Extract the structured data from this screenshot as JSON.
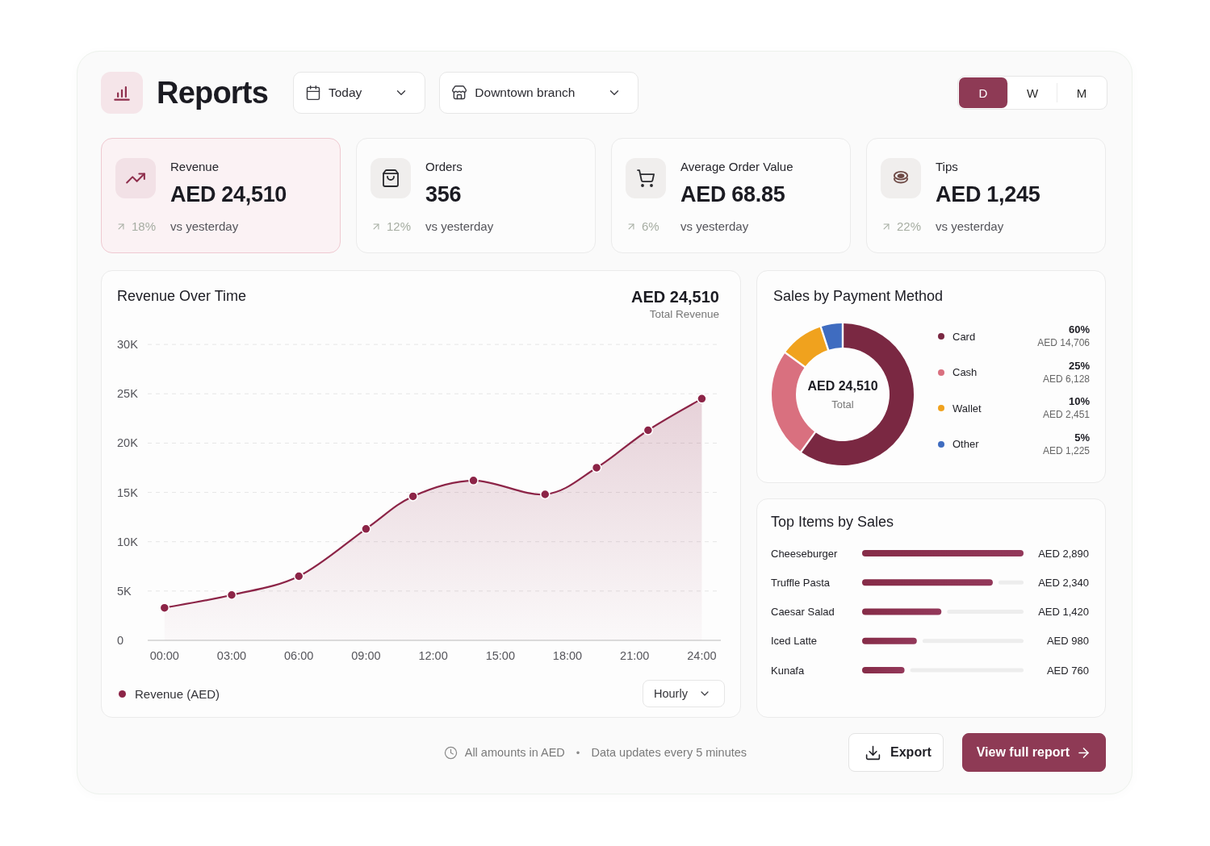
{
  "header": {
    "title": "Reports",
    "filters": [
      {
        "kind": "date",
        "label": "Today"
      },
      {
        "kind": "branch",
        "label": "Downtown branch"
      }
    ],
    "periods": [
      {
        "label": "D",
        "selected": true
      },
      {
        "label": "W",
        "selected": false
      },
      {
        "label": "M",
        "selected": false
      }
    ]
  },
  "kpis": [
    {
      "kind": "revenue",
      "label": "Revenue",
      "value": "AED 24,510",
      "change": "18%",
      "comparison": "vs yesterday",
      "selected": true
    },
    {
      "kind": "orders",
      "label": "Orders",
      "value": "356",
      "change": "12%",
      "comparison": "vs yesterday",
      "selected": false
    },
    {
      "kind": "average_order",
      "label": "Average Order Value",
      "value": "AED 68.85",
      "change": "6%",
      "comparison": "vs yesterday",
      "selected": false
    },
    {
      "kind": "tips",
      "label": "Tips",
      "value": "AED 1,245",
      "change": "22%",
      "comparison": "vs yesterday",
      "selected": false
    }
  ],
  "revenue_chart": {
    "title": "Revenue Over Time",
    "total": "AED 24,510",
    "total_label": "Total Revenue",
    "interval": "Hourly",
    "chart_data": {
      "type": "area",
      "x": [
        0,
        3,
        6,
        9,
        11.1,
        13.8,
        17,
        19.3,
        21.6,
        24
      ],
      "series": [
        {
          "name": "Revenue (AED)",
          "color": "#8c2447",
          "values": [
            3300,
            4600,
            6500,
            11300,
            14600,
            16200,
            14800,
            17500,
            21300,
            24500
          ]
        }
      ],
      "xlim": [
        -0.75,
        24.85
      ],
      "ylim": [
        0,
        30000
      ],
      "xticks": [
        {
          "value": 0,
          "label": "00:00"
        },
        {
          "value": 3,
          "label": "03:00"
        },
        {
          "value": 6,
          "label": "06:00"
        },
        {
          "value": 9,
          "label": "09:00"
        },
        {
          "value": 12,
          "label": "12:00"
        },
        {
          "value": 15,
          "label": "15:00"
        },
        {
          "value": 18,
          "label": "18:00"
        },
        {
          "value": 21,
          "label": "21:00"
        },
        {
          "value": 24,
          "label": "24:00"
        }
      ],
      "yticks": [
        {
          "value": 0,
          "label": "0"
        },
        {
          "value": 5000,
          "label": "5K"
        },
        {
          "value": 10000,
          "label": "10K"
        },
        {
          "value": 15000,
          "label": "15K"
        },
        {
          "value": 20000,
          "label": "20K"
        },
        {
          "value": 25000,
          "label": "25K"
        },
        {
          "value": 30000,
          "label": "30K"
        }
      ],
      "grid": true
    }
  },
  "payment_methods": {
    "title": "Sales by Payment Method",
    "center_value": "AED 24,510",
    "center_label": "Total",
    "chart_data": {
      "type": "donut",
      "categories": [
        "Card",
        "Cash",
        "Wallet",
        "Other"
      ],
      "values": [
        60,
        25,
        10,
        5
      ]
    },
    "legend": [
      {
        "color": "#7a2842",
        "percent": "60%",
        "amount": "AED 14,706"
      },
      {
        "color": "#d9707f",
        "percent": "25%",
        "amount": "AED 6,128"
      },
      {
        "color": "#f0a21e",
        "percent": "10%",
        "amount": "AED 2,451"
      },
      {
        "color": "#3f6cc0",
        "percent": "5%",
        "amount": "AED 1,225"
      }
    ]
  },
  "top_items": {
    "title": "Top Items by Sales",
    "chart_data": {
      "type": "bar",
      "orientation": "horizontal",
      "categories": [
        "Cheeseburger",
        "Truffle Pasta",
        "Caesar Salad",
        "Iced Latte",
        "Kunafa"
      ],
      "values": [
        2890,
        2340,
        1420,
        980,
        760
      ],
      "xlim": [
        0,
        2890
      ],
      "value_labels": [
        "AED 2,890",
        "AED 2,340",
        "AED 1,420",
        "AED 980",
        "AED 760"
      ]
    }
  },
  "footer": {
    "notes": [
      "All amounts in AED",
      "Data updates every 5 minutes"
    ],
    "separator": "•",
    "actions": [
      {
        "kind": "export",
        "label": "Export"
      },
      {
        "kind": "primary",
        "label": "View full report"
      }
    ]
  }
}
